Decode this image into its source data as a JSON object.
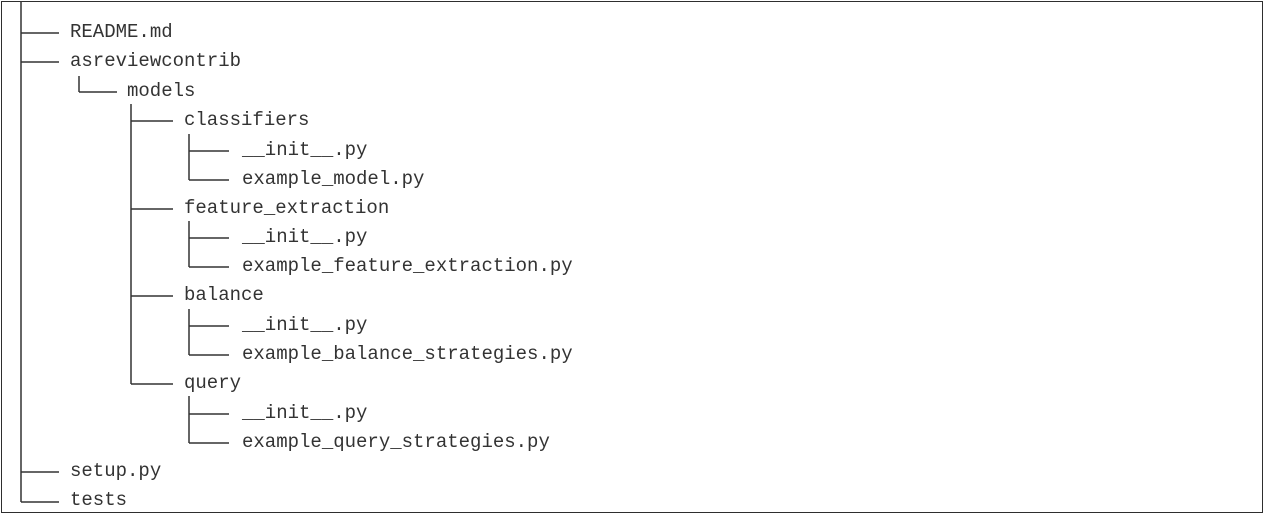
{
  "tree": {
    "readme": "README.md",
    "asreviewcontrib": "asreviewcontrib",
    "models": "models",
    "classifiers": "classifiers",
    "classifiers_init": "__init__.py",
    "classifiers_example": "example_model.py",
    "feature_extraction": "feature_extraction",
    "feature_extraction_init": "__init__.py",
    "feature_extraction_example": "example_feature_extraction.py",
    "balance": "balance",
    "balance_init": "__init__.py",
    "balance_example": "example_balance_strategies.py",
    "query": "query",
    "query_init": "__init__.py",
    "query_example": "example_query_strategies.py",
    "setup": "setup.py",
    "tests": "tests"
  }
}
